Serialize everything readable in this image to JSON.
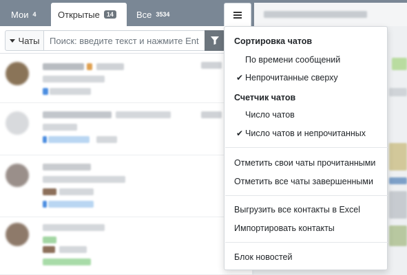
{
  "tabs": [
    {
      "label": "Мои",
      "count": "4"
    },
    {
      "label": "Открытые",
      "count": "14"
    },
    {
      "label": "Все",
      "count": "3534"
    }
  ],
  "filter": {
    "label": "Чаты",
    "search_placeholder": "Поиск: введите текст и нажмите Enter"
  },
  "icons": {
    "menu": "hamburger-icon",
    "filter": "funnel-icon",
    "dropdown": "caret-down-icon",
    "check": "checkmark-icon"
  },
  "menu": {
    "sort_header": "Сортировка чатов",
    "sort_by_time": "По времени сообщений",
    "unread_on_top": "Непрочитанные сверху",
    "counter_header": "Счетчик чатов",
    "chat_count": "Число чатов",
    "chat_and_unread_count": "Число чатов и непрочитанных",
    "mark_own_read": "Отметить свои чаты прочитанными",
    "mark_all_done": "Отметить все чаты завершенными",
    "export_contacts": "Выгрузить все контакты в Excel",
    "import_contacts": "Импортировать контакты",
    "news_block": "Блок новостей",
    "check_mark": "✔"
  },
  "colors": {
    "tabbar": "#7a8795",
    "filter_button": "#6c757d",
    "badge": "#6c757d"
  }
}
